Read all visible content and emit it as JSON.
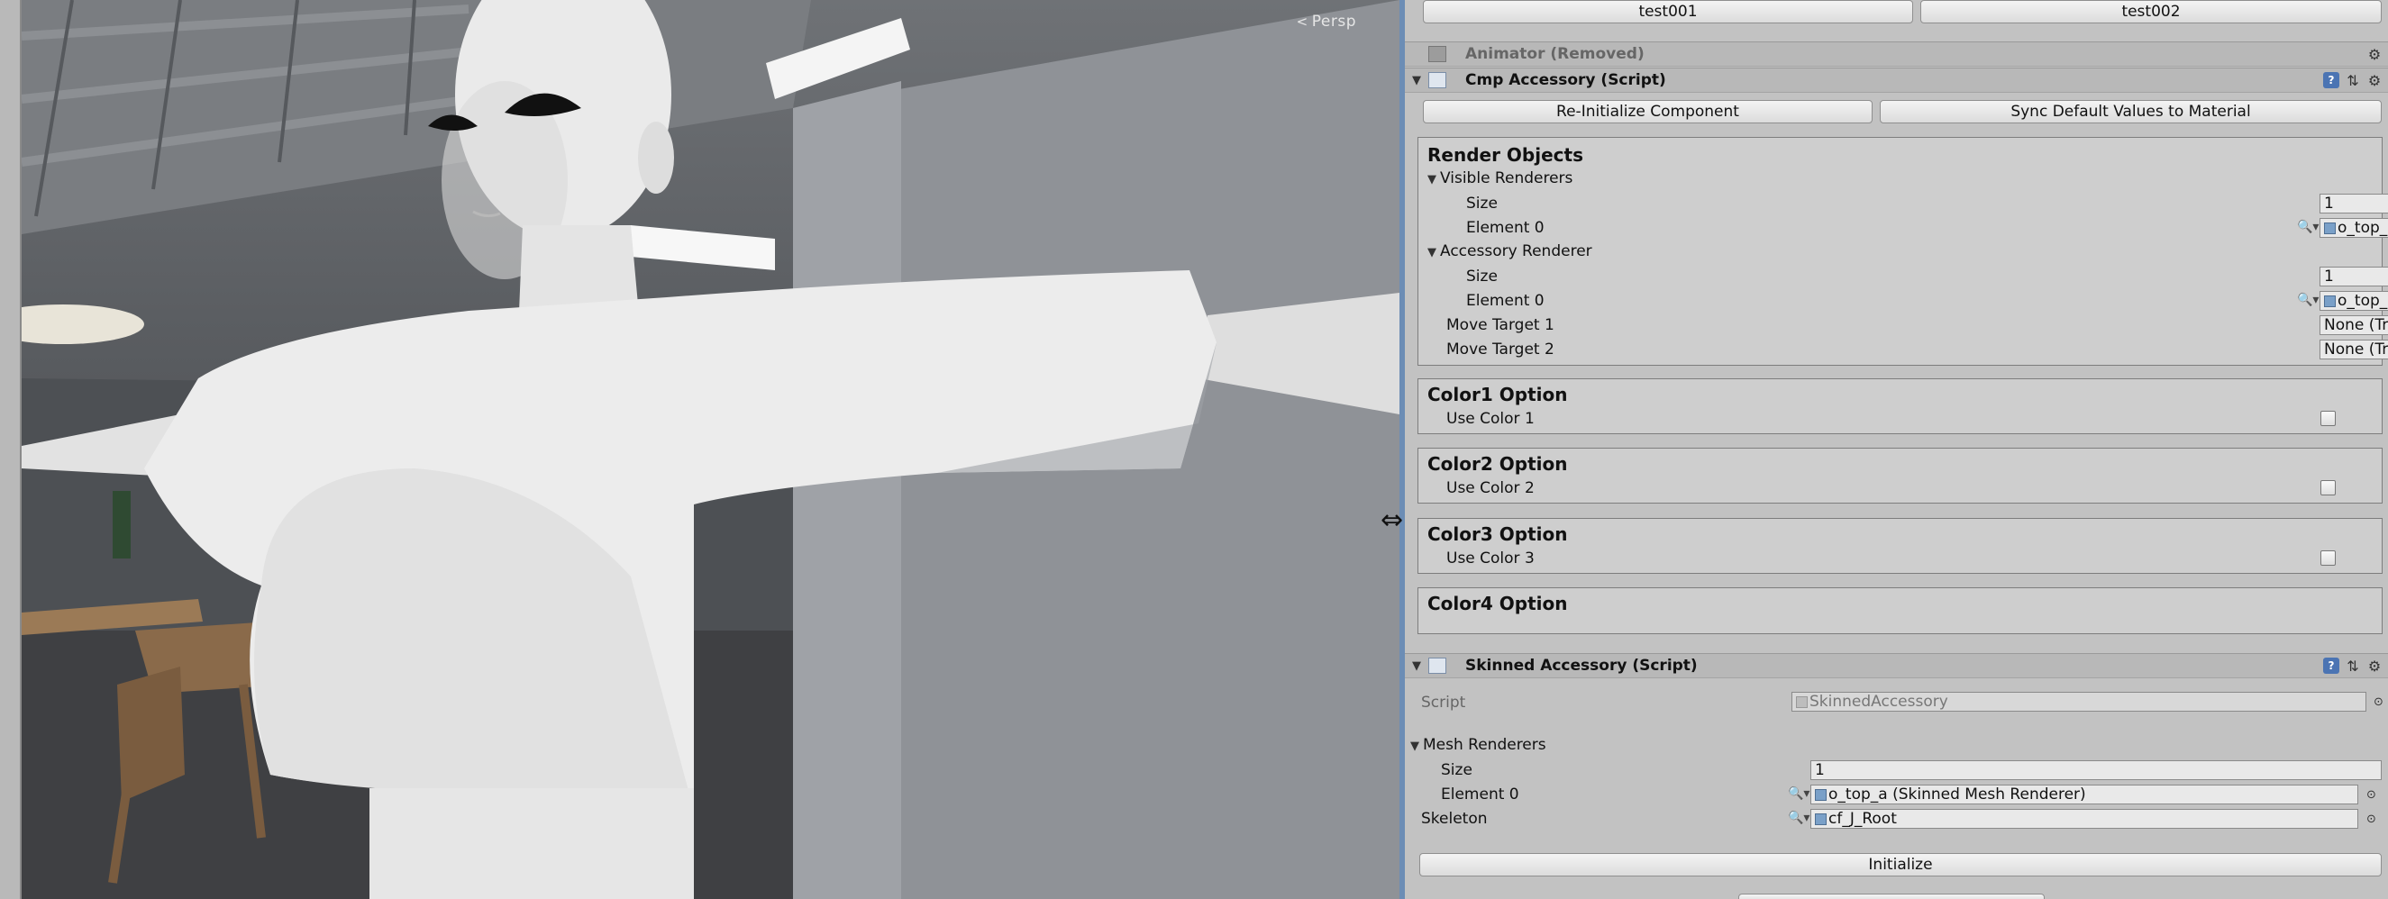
{
  "scene": {
    "view_mode": "Persp",
    "colors": {
      "sky": "#6f7276",
      "wall": "#8e9196",
      "skin": "#e9e9e9",
      "floor": "#3c3d40",
      "table": "#8a6a4a"
    }
  },
  "inspector": {
    "top_buttons": [
      "test001",
      "test002"
    ],
    "animator": {
      "title": "Animator (Removed)"
    },
    "cmp_accessory": {
      "title": "Cmp Accessory (Script)",
      "buttons": [
        "Re-Initialize Component",
        "Sync Default Values to Material"
      ],
      "render_objects": {
        "heading": "Render Objects",
        "visible_renderers": {
          "label": "Visible Renderers",
          "size_label": "Size",
          "size": "1",
          "element_label": "Element 0",
          "element_value": "o_top_a (Skinned Mesh Renderer)"
        },
        "accessory_renderer": {
          "label": "Accessory Renderer",
          "size_label": "Size",
          "size": "1",
          "element_label": "Element 0",
          "element_value": "o_top_a (Skinned Mesh Renderer)"
        },
        "move_target_1": {
          "label": "Move Target 1",
          "value": "None (Transform)"
        },
        "move_target_2": {
          "label": "Move Target 2",
          "value": "None (Transform)"
        }
      },
      "color_options": [
        {
          "heading": "Color1 Option",
          "toggle_label": "Use Color 1",
          "checked": false
        },
        {
          "heading": "Color2 Option",
          "toggle_label": "Use Color 2",
          "checked": false
        },
        {
          "heading": "Color3 Option",
          "toggle_label": "Use Color 3",
          "checked": false
        },
        {
          "heading": "Color4 Option"
        }
      ]
    },
    "skinned_accessory": {
      "title": "Skinned Accessory (Script)",
      "script_label": "Script",
      "script_value": "SkinnedAccessory",
      "mesh_renderers": {
        "label": "Mesh Renderers",
        "size_label": "Size",
        "size": "1",
        "element_label": "Element 0",
        "element_value": "o_top_a (Skinned Mesh Renderer)"
      },
      "skeleton": {
        "label": "Skeleton",
        "value": "cf_J_Root"
      },
      "initialize_button": "Initialize"
    }
  }
}
